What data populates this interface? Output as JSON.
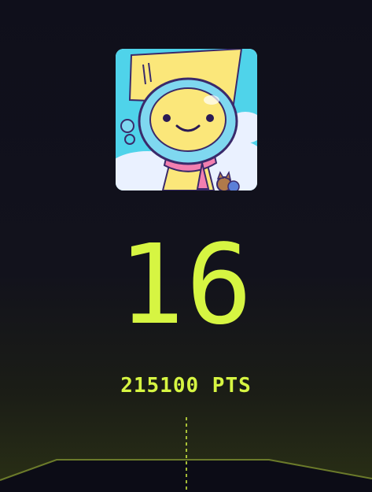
{
  "profile": {
    "avatar_icon": "cartoon-diver-avatar-icon"
  },
  "score": {
    "rank": "16",
    "points": "215100 PTS"
  },
  "colors": {
    "background": "#0f0f1a",
    "accent": "#d6f542",
    "floor_line": "#6b7a2a"
  }
}
